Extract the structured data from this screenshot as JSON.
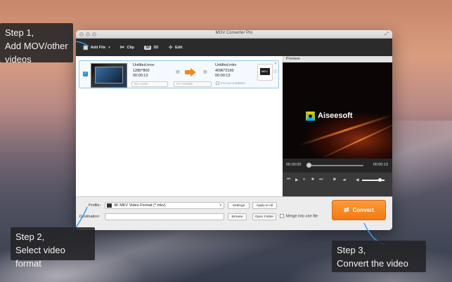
{
  "window": {
    "title": "MOV Converter Pro"
  },
  "toolbar": {
    "add_file": "Add File",
    "clip": "Clip",
    "three_d_badge": "3D",
    "three_d": "3D",
    "edit": "Edit"
  },
  "file_row": {
    "source": {
      "name": "Untitled.mov",
      "resolution": "1280*800",
      "duration": "00:00:13"
    },
    "target": {
      "name": "Untitled.mkv",
      "resolution": "4096*2160",
      "duration": "00:00:13"
    },
    "audio_select": "No Audio",
    "subtitle_select": "No Subtitle",
    "forced_subtitles": "Forced Subtitles"
  },
  "preview": {
    "label": "Preview",
    "logo_text": "Aiseesoft",
    "time_current": "00:00:00",
    "time_total": "00:00:13",
    "progress": 0.0,
    "volume": 0.8
  },
  "bottom": {
    "profile_label": "Profile:",
    "profile_value": "4K MKV Video Format (*.mkv)",
    "settings": "Settings",
    "apply_to_all": "Apply to All",
    "destination_label": "Destination:",
    "destination_value": "",
    "browse": "Browse",
    "open_folder": "Open Folder",
    "merge": "Merge into one file",
    "convert": "Convert"
  },
  "callouts": {
    "step1": [
      "Step 1,",
      "Add MOV/other",
      "videos"
    ],
    "step2": [
      "Step 2,",
      "Select video format"
    ],
    "step3": [
      "Step 3,",
      "Convert the video"
    ]
  },
  "colors": {
    "accent": "#f4861f",
    "selection": "#2d8de3",
    "callout_line": "#3a9be8"
  }
}
